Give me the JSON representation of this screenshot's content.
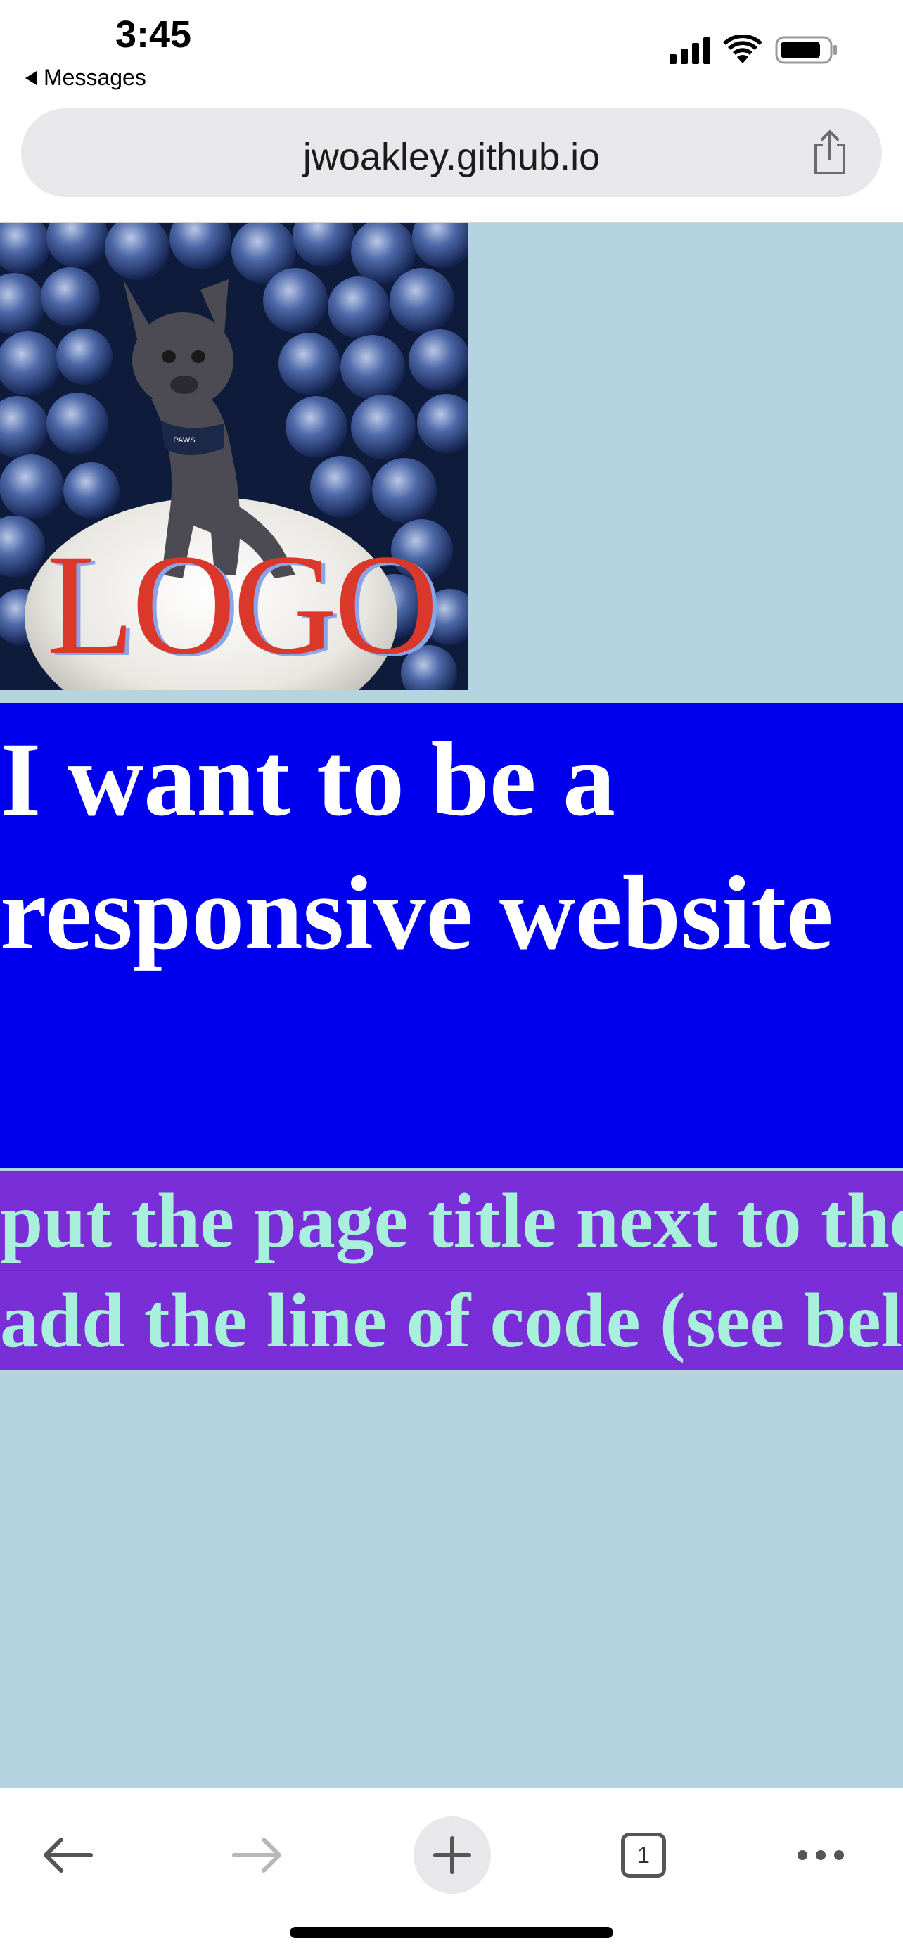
{
  "status_bar": {
    "time": "3:45",
    "back_label": "Messages",
    "icons": [
      "signal-icon",
      "wifi-icon",
      "battery-icon"
    ]
  },
  "browser": {
    "url": "jwoakley.github.io",
    "toolbar": {
      "tab_count": "1",
      "icons": [
        "back-arrow-icon",
        "forward-arrow-icon",
        "plus-icon",
        "tabs-icon",
        "more-icon"
      ]
    }
  },
  "page": {
    "background": "#b3d4e0",
    "logo": {
      "text": "LOGO",
      "color": "#d9382b"
    },
    "hero": {
      "heading": "I want to be a responsive website",
      "background": "#0000ee",
      "color": "#ffffff"
    },
    "note": {
      "line1": "put the page title next to the logo and",
      "line2": "add the line of code (see below)",
      "background": "#7a2ed8",
      "color": "#a8f0dc"
    }
  }
}
